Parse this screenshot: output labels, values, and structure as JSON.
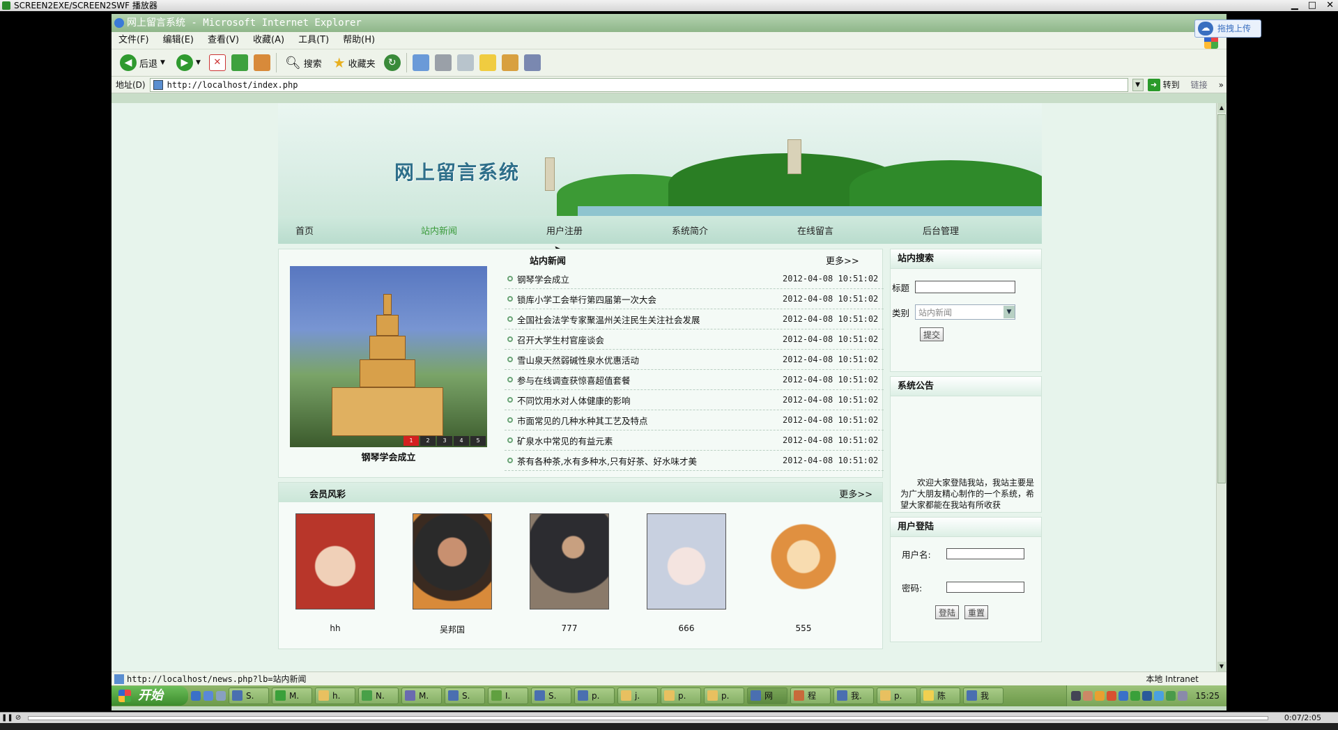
{
  "player": {
    "title": "SCREEN2EXE/SCREEN2SWF 播放器",
    "time": "0:07/2:05"
  },
  "ie": {
    "title": "网上留言系统 - Microsoft Internet Explorer",
    "upload_label": "拖拽上传",
    "menu": [
      "文件(F)",
      "编辑(E)",
      "查看(V)",
      "收藏(A)",
      "工具(T)",
      "帮助(H)"
    ],
    "toolbar": {
      "back": "后退",
      "search": "搜索",
      "favorites": "收藏夹"
    },
    "address_label": "地址(D)",
    "address": "http://localhost/index.php",
    "goto": "转到",
    "links": "链接",
    "status_url": "http://localhost/news.php?lb=站内新闻",
    "zone": "本地 Intranet"
  },
  "site": {
    "banner_title": "网上留言系统",
    "nav": [
      "首页",
      "站内新闻",
      "用户注册",
      "系统简介",
      "在线留言",
      "后台管理"
    ],
    "news": {
      "heading": "站内新闻",
      "more": "更多>>",
      "photo_caption": "钢琴学会成立",
      "photo_pages": [
        "1",
        "2",
        "3",
        "4",
        "5"
      ],
      "items": [
        {
          "title": "钢琴学会成立",
          "date": "2012-04-08 10:51:02"
        },
        {
          "title": "锁库小学工会举行第四届第一次大会",
          "date": "2012-04-08 10:51:02"
        },
        {
          "title": "全国社会法学专家聚温州关注民生关注社会发展",
          "date": "2012-04-08 10:51:02"
        },
        {
          "title": "召开大学生村官座谈会",
          "date": "2012-04-08 10:51:02"
        },
        {
          "title": "雪山泉天然弱碱性泉水优惠活动",
          "date": "2012-04-08 10:51:02"
        },
        {
          "title": "参与在线调查获惊喜超值套餐",
          "date": "2012-04-08 10:51:02"
        },
        {
          "title": "不同饮用水对人体健康的影响",
          "date": "2012-04-08 10:51:02"
        },
        {
          "title": "市面常见的几种水种其工艺及特点",
          "date": "2012-04-08 10:51:02"
        },
        {
          "title": "矿泉水中常见的有益元素",
          "date": "2012-04-08 10:51:02"
        },
        {
          "title": "茶有各种茶,水有多种水,只有好茶、好水味才美",
          "date": "2012-04-08 10:51:02"
        }
      ]
    },
    "members": {
      "heading": "会员风彩",
      "more": "更多>>",
      "list": [
        {
          "name": "hh",
          "color": "#b8362a"
        },
        {
          "name": "吴邦国",
          "color": "#7a4a2a"
        },
        {
          "name": "777",
          "color": "#5a4a3a"
        },
        {
          "name": "666",
          "color": "#c8d0e0"
        },
        {
          "name": "555",
          "color": "#e09040"
        }
      ]
    },
    "search": {
      "heading": "站内搜索",
      "title_label": "标题",
      "category_label": "类别",
      "category_value": "站内新闻",
      "submit": "提交"
    },
    "notice": {
      "heading": "系统公告",
      "text": "欢迎大家登陆我站，我站主要是为广大朋友精心制作的一个系统，希望大家都能在我站有所收获"
    },
    "login": {
      "heading": "用户登陆",
      "username_label": "用户名:",
      "password_label": "密码:",
      "login_button": "登陆",
      "reset_button": "重置"
    }
  },
  "taskbar": {
    "start": "开始",
    "items": [
      "S.",
      "M.",
      "h.",
      "N.",
      "M.",
      "S.",
      "I.",
      "S.",
      "p.",
      "j.",
      "p.",
      "p.",
      "网",
      "程",
      "我.",
      "p.",
      "陈",
      "我"
    ],
    "active_index": 12,
    "clock": "15:25"
  }
}
